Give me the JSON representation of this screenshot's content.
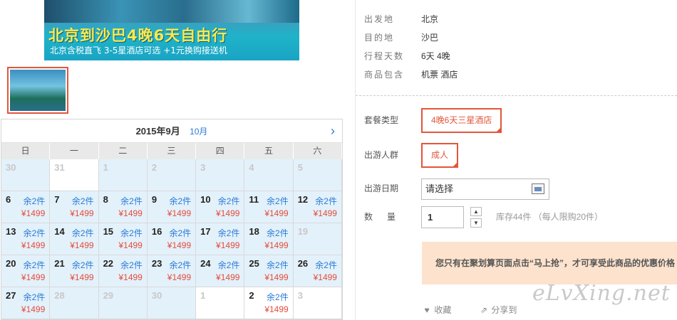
{
  "banner": {
    "title": "北京到沙巴4晚6天自由行",
    "subtitle": "北京含税直飞 3-5星酒店可选 +1元换购接送机"
  },
  "calendar": {
    "current_month": "2015年9月",
    "next_month": "10月",
    "weekdays": [
      "日",
      "一",
      "二",
      "三",
      "四",
      "五",
      "六"
    ],
    "weeks": [
      [
        {
          "day": "30",
          "muted": true
        },
        {
          "day": "31",
          "muted": true
        },
        {
          "day": "1",
          "muted": true
        },
        {
          "day": "2",
          "muted": true
        },
        {
          "day": "3",
          "muted": true
        },
        {
          "day": "4",
          "muted": true
        },
        {
          "day": "5",
          "muted": true
        }
      ],
      [
        {
          "day": "6",
          "stock": "余2件",
          "price": "¥1499"
        },
        {
          "day": "7",
          "stock": "余2件",
          "price": "¥1499"
        },
        {
          "day": "8",
          "stock": "余2件",
          "price": "¥1499"
        },
        {
          "day": "9",
          "stock": "余2件",
          "price": "¥1499"
        },
        {
          "day": "10",
          "stock": "余2件",
          "price": "¥1499"
        },
        {
          "day": "11",
          "stock": "余2件",
          "price": "¥1499"
        },
        {
          "day": "12",
          "stock": "余2件",
          "price": "¥1499"
        }
      ],
      [
        {
          "day": "13",
          "stock": "余2件",
          "price": "¥1499"
        },
        {
          "day": "14",
          "stock": "余2件",
          "price": "¥1499"
        },
        {
          "day": "15",
          "stock": "余2件",
          "price": "¥1499"
        },
        {
          "day": "16",
          "stock": "余2件",
          "price": "¥1499"
        },
        {
          "day": "17",
          "stock": "余2件",
          "price": "¥1499"
        },
        {
          "day": "18",
          "stock": "余2件",
          "price": "¥1499"
        },
        {
          "day": "19",
          "muted": true
        }
      ],
      [
        {
          "day": "20",
          "stock": "余2件",
          "price": "¥1499"
        },
        {
          "day": "21",
          "stock": "余2件",
          "price": "¥1499"
        },
        {
          "day": "22",
          "stock": "余2件",
          "price": "¥1499"
        },
        {
          "day": "23",
          "stock": "余2件",
          "price": "¥1499"
        },
        {
          "day": "24",
          "stock": "余2件",
          "price": "¥1499"
        },
        {
          "day": "25",
          "stock": "余2件",
          "price": "¥1499"
        },
        {
          "day": "26",
          "stock": "余2件",
          "price": "¥1499"
        }
      ],
      [
        {
          "day": "27",
          "stock": "余2件",
          "price": "¥1499"
        },
        {
          "day": "28",
          "muted": true
        },
        {
          "day": "29",
          "muted": true
        },
        {
          "day": "30",
          "muted": true
        },
        {
          "day": "1",
          "muted": true,
          "white": true
        },
        {
          "day": "2",
          "stock": "余2件",
          "price": "¥1499",
          "white": true
        },
        {
          "day": "3",
          "muted": true,
          "white": true
        }
      ]
    ]
  },
  "product_info": [
    {
      "label": "出发地",
      "value": "北京"
    },
    {
      "label": "目的地",
      "value": "沙巴"
    },
    {
      "label": "行程天数",
      "value": "6天 4晚"
    },
    {
      "label": "商品包含",
      "value": "机票  酒店"
    }
  ],
  "options": {
    "package_label": "套餐类型",
    "package_value": "4晚6天三星酒店",
    "group_label": "出游人群",
    "group_value": "成人",
    "date_label": "出游日期",
    "date_placeholder": "请选择",
    "qty_label": "数量",
    "qty_value": "1",
    "stock_note": "库存44件  （每人限购20件）"
  },
  "notice": "您只有在聚划算页面点击“马上抢”，才可享受此商品的优惠价格",
  "actions": {
    "favorite": "收藏",
    "share": "分享到"
  },
  "watermark": "eLvXing.net",
  "colors": {
    "accent": "#e4553a",
    "link": "#2b7bd4",
    "cell_tint": "#e3f1fb",
    "notice_bg": "#fde2cd"
  }
}
